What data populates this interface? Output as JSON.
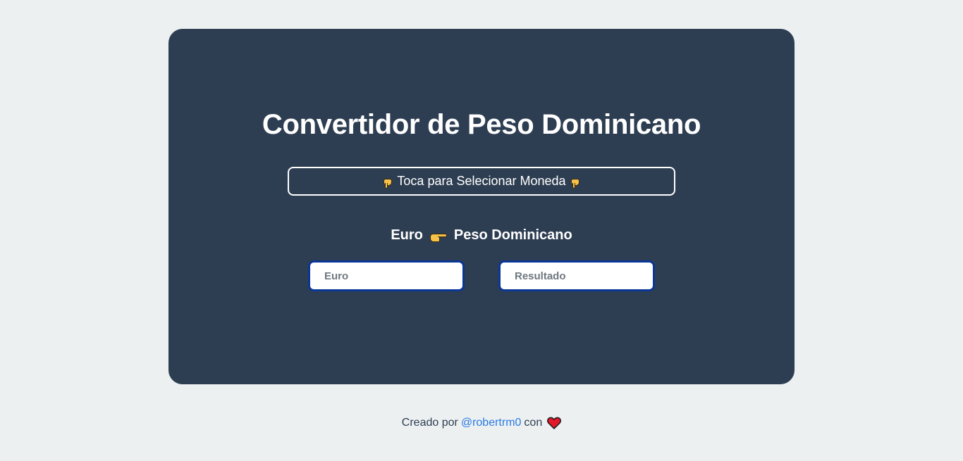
{
  "header": {
    "title": "Convertidor de Peso Dominicano"
  },
  "currency_selector": {
    "label": "Toca para Selecionar Moneda"
  },
  "conversion": {
    "from_label": "Euro",
    "to_label": "Peso Dominicano",
    "input_placeholder": "Euro",
    "result_placeholder": "Resultado"
  },
  "footer": {
    "prefix": "Creado por",
    "author_link": "@robertrm0",
    "suffix": "con",
    "heart_icon": "heart-icon"
  },
  "colors": {
    "background": "#ecf0f1",
    "card": "#2e3e52",
    "input_border": "#0a3696",
    "link": "#2a7ae2"
  }
}
